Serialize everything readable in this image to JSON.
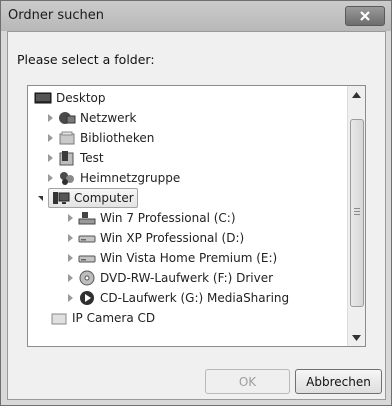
{
  "window": {
    "title": "Ordner suchen"
  },
  "dialog": {
    "prompt": "Please select a folder:"
  },
  "tree": {
    "items": [
      {
        "label": "Desktop",
        "icon": "desktop-icon",
        "expander": "none"
      },
      {
        "label": "Netzwerk",
        "icon": "network-icon",
        "expander": "collapsed"
      },
      {
        "label": "Bibliotheken",
        "icon": "libraries-icon",
        "expander": "collapsed"
      },
      {
        "label": "Test",
        "icon": "user-folder-icon",
        "expander": "collapsed"
      },
      {
        "label": "Heimnetzgruppe",
        "icon": "homegroup-icon",
        "expander": "collapsed"
      },
      {
        "label": "Computer",
        "icon": "computer-icon",
        "expander": "expanded",
        "selected": true
      },
      {
        "label": "Win 7 Professional (C:)",
        "icon": "system-drive-icon",
        "expander": "collapsed"
      },
      {
        "label": "Win XP Professional (D:)",
        "icon": "hard-drive-icon",
        "expander": "collapsed"
      },
      {
        "label": "Win Vista Home Premium (E:)",
        "icon": "hard-drive-icon",
        "expander": "collapsed"
      },
      {
        "label": "DVD-RW-Laufwerk (F:) Driver",
        "icon": "dvd-drive-icon",
        "expander": "collapsed"
      },
      {
        "label": "CD-Laufwerk (G:) MediaSharing",
        "icon": "cd-media-icon",
        "expander": "collapsed"
      },
      {
        "label": "IP Camera CD",
        "icon": "folder-icon",
        "expander": "none"
      }
    ]
  },
  "buttons": {
    "ok": "OK",
    "cancel": "Abbrechen"
  }
}
